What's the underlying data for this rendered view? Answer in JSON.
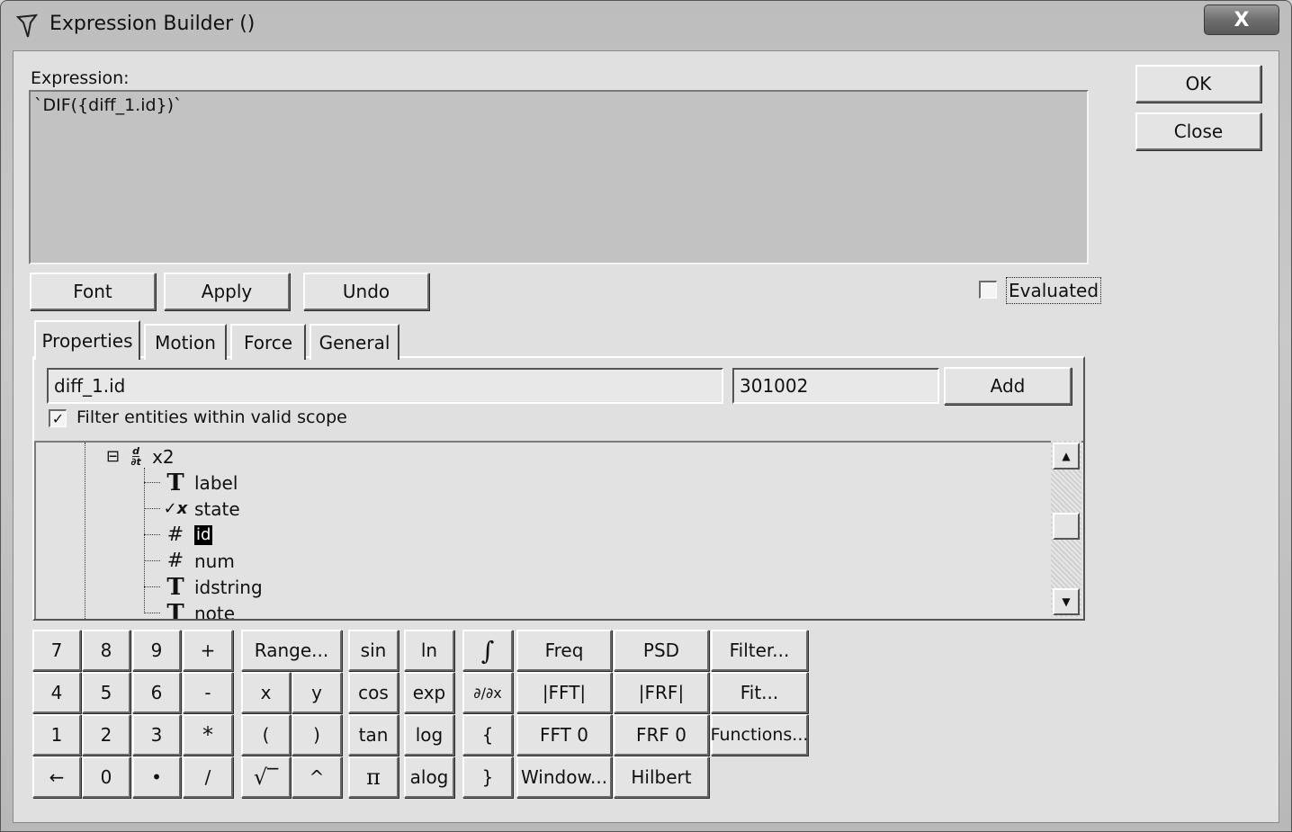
{
  "window": {
    "title": "Expression Builder ()",
    "close_glyph": "X"
  },
  "buttons": {
    "ok": "OK",
    "close": "Close",
    "font": "Font",
    "apply": "Apply",
    "undo": "Undo",
    "add": "Add"
  },
  "expression": {
    "label": "Expression:",
    "value": "`DIF({diff_1.id})`"
  },
  "evaluated": {
    "label": "Evaluated",
    "checked": false
  },
  "tabs": [
    {
      "label": "Properties",
      "active": true
    },
    {
      "label": "Motion",
      "active": false
    },
    {
      "label": "Force",
      "active": false
    },
    {
      "label": "General",
      "active": false
    }
  ],
  "properties": {
    "entity_field": "diff_1.id",
    "value_field": "301002",
    "filter_label": "Filter entities within valid scope",
    "filter_checked": true
  },
  "tree": {
    "parent": {
      "label": "x2",
      "icon": "derivative-icon",
      "expander": "⊟"
    },
    "children": [
      {
        "label": "label",
        "icon": "text-icon",
        "glyph": "T"
      },
      {
        "label": "state",
        "icon": "state-icon",
        "glyph": "✓x"
      },
      {
        "label": "id",
        "icon": "number-icon",
        "glyph": "#",
        "selected": true
      },
      {
        "label": "num",
        "icon": "number-icon",
        "glyph": "#"
      },
      {
        "label": "idstring",
        "icon": "text-icon",
        "glyph": "T"
      },
      {
        "label": "note",
        "icon": "text-icon",
        "glyph": "T"
      }
    ]
  },
  "keypad": {
    "r1": [
      "7",
      "8",
      "9",
      "+"
    ],
    "r2": [
      "4",
      "5",
      "6",
      "-"
    ],
    "r3": [
      "1",
      "2",
      "3",
      "*"
    ],
    "r4": [
      "←",
      "0",
      "•",
      "/"
    ],
    "range": "Range...",
    "x": "x",
    "y": "y",
    "lparen": "(",
    "rparen": ")",
    "sqrt": "√‾",
    "caret": "^",
    "sin": "sin",
    "cos": "cos",
    "tan": "tan",
    "pi": "π",
    "ln": "ln",
    "exp": "exp",
    "log": "log",
    "alog": "alog",
    "integral": "∫",
    "derivative": "∂/∂x",
    "lbrace": "{",
    "rbrace": "}",
    "freq": "Freq",
    "fft": "|FFT|",
    "fft0": "FFT 0",
    "window": "Window...",
    "psd": "PSD",
    "frf": "|FRF|",
    "frf0": "FRF 0",
    "hilbert": "Hilbert",
    "filter": "Filter...",
    "fit": "Fit...",
    "functions": "Functions..."
  }
}
